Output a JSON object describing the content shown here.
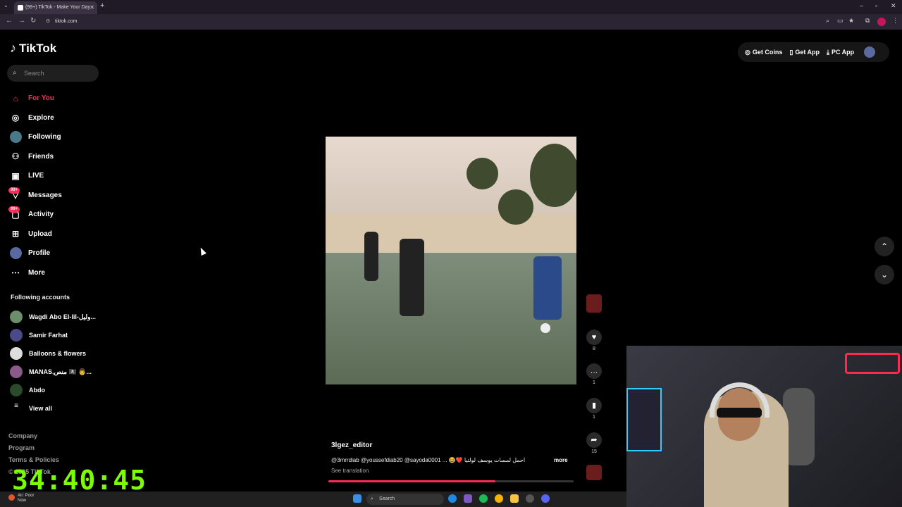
{
  "browser": {
    "tab_title": "(99+) TikTok - Make Your Day",
    "url": "tiktok.com"
  },
  "app": {
    "logo_text": "TikTok",
    "search_placeholder": "Search"
  },
  "nav": [
    {
      "label": "For You",
      "icon": "home-icon",
      "active": true
    },
    {
      "label": "Explore",
      "icon": "compass-icon"
    },
    {
      "label": "Following",
      "icon": "following-avatar"
    },
    {
      "label": "Friends",
      "icon": "friends-icon"
    },
    {
      "label": "LIVE",
      "icon": "live-icon"
    },
    {
      "label": "Messages",
      "icon": "messages-icon",
      "badge": "99+"
    },
    {
      "label": "Activity",
      "icon": "activity-icon",
      "badge": "99+"
    },
    {
      "label": "Upload",
      "icon": "upload-icon"
    },
    {
      "label": "Profile",
      "icon": "profile-avatar"
    },
    {
      "label": "More",
      "icon": "more-icon"
    }
  ],
  "following_title": "Following accounts",
  "following": [
    {
      "name": "Wagdi Abo El-lil-وليل...",
      "color": "#6a8f6a"
    },
    {
      "name": "Samir Farhat",
      "color": "#4a4a8a"
    },
    {
      "name": "Balloons & flowers",
      "color": "#dddddd"
    },
    {
      "name": "MANAS,منص 🏴‍☠️ 👨...",
      "color": "#8a5a8a"
    },
    {
      "name": "Abdo",
      "color": "#2a4a2a"
    },
    {
      "name": "View all",
      "color": ""
    }
  ],
  "footer": [
    "Company",
    "Program",
    "Terms & Policies"
  ],
  "footer_copyright": "© 2025 TikTok",
  "timer": "34:40:45",
  "top_actions": {
    "coins": "Get Coins",
    "app": "Get App",
    "pc_app": "PC App"
  },
  "video": {
    "author": "3lgez_editor",
    "caption": "@3mrrdiab @youssefdiab20 @sayoda0001 ... 😂❤️ احمل لمسات يوسف لولتيا",
    "more": "more",
    "see_translation": "See translation",
    "progress": 0.68
  },
  "rail": {
    "likes": "8",
    "comments": "1",
    "saves": "1",
    "shares": "15"
  },
  "taskbar": {
    "weather_line1": "Air: Poor",
    "weather_line2": "Now",
    "search": "Search"
  },
  "colors": {
    "accent": "#fe2c55",
    "timer": "#7CFC00"
  }
}
